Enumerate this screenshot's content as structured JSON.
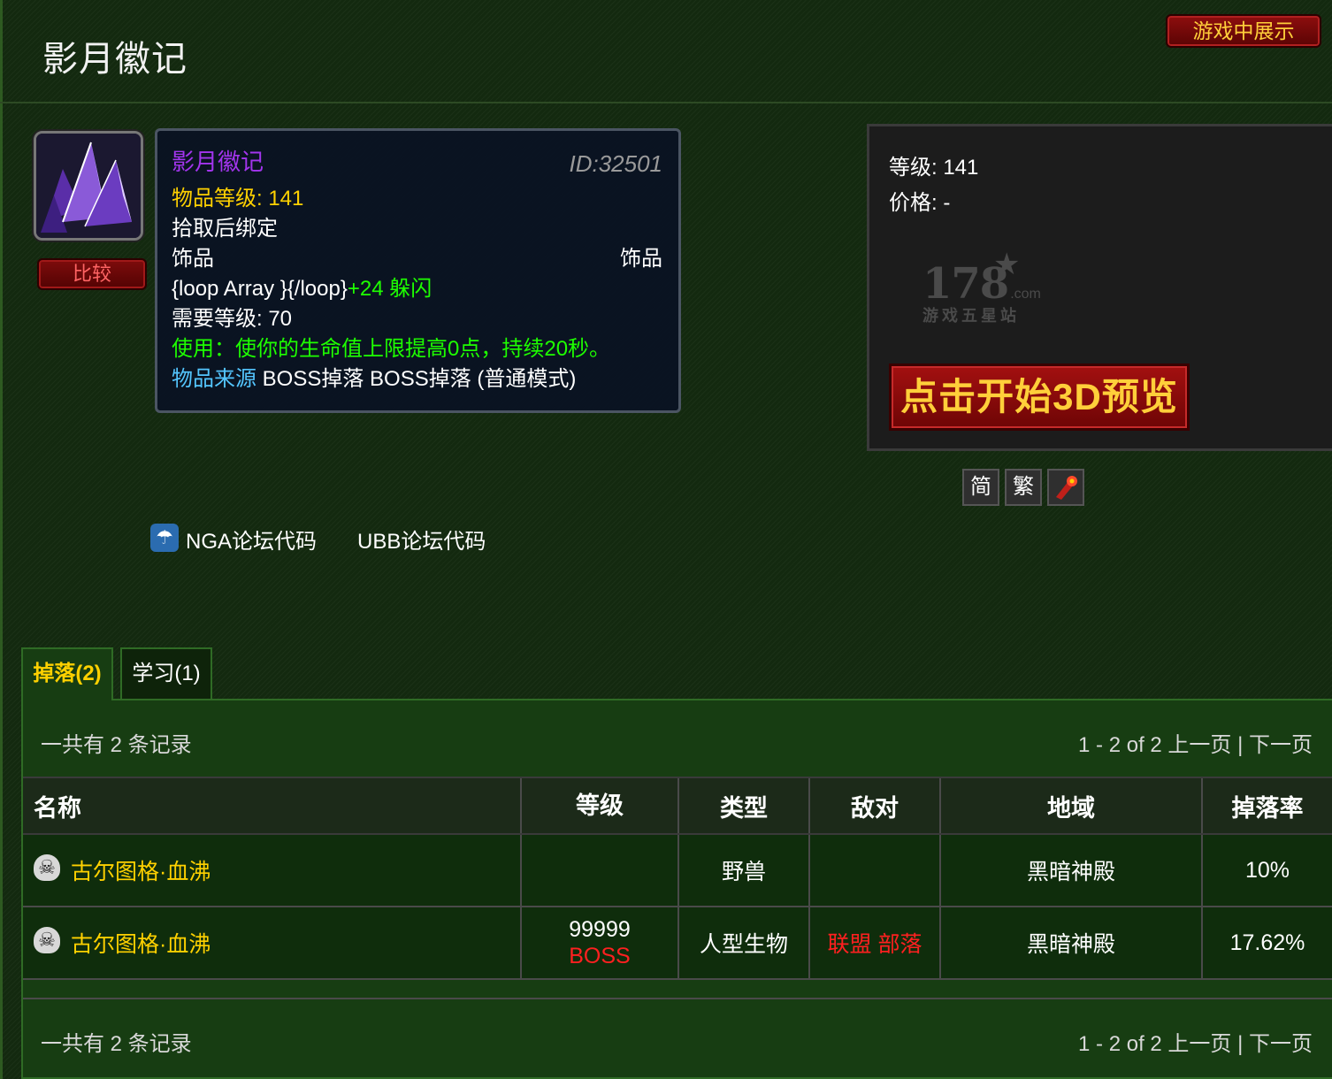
{
  "header": {
    "title": "影月徽记",
    "ingame_button": "游戏中展示"
  },
  "item": {
    "icon": "purple-crystal-icon",
    "compare_button": "比较",
    "tooltip": {
      "name": "影月徽记",
      "id": "ID:32501",
      "item_level": "物品等级: 141",
      "bind": "拾取后绑定",
      "slot": "饰品",
      "slot_type": "饰品",
      "stat_prefix": "{loop Array }{/loop}",
      "stat_bonus": "+24 躲闪",
      "required_level": "需要等级: 70",
      "use_effect": "使用：使你的生命值上限提高0点，持续20秒。",
      "source_label": "物品来源",
      "source_value": " BOSS掉落 BOSS掉落 (普通模式)"
    }
  },
  "info": {
    "level": "等级: 141",
    "price": "价格: -",
    "watermark_num": "178",
    "watermark_com": ".com",
    "watermark_sub": "游戏五星站",
    "preview_button": "点击开始3D预览"
  },
  "lang_buttons": {
    "simplified": "简",
    "traditional": "繁",
    "tool_icon": "wowhead-tool-icon"
  },
  "forum": {
    "nga_label": "NGA论坛代码",
    "ubb_label": "UBB论坛代码"
  },
  "tabs": [
    {
      "label": "掉落(2)",
      "active": true
    },
    {
      "label": "学习(1)",
      "active": false
    }
  ],
  "drops": {
    "count_text": "一共有 2 条记录",
    "pager_text": "1 - 2 of 2 上一页 | 下一页",
    "columns": [
      "名称",
      "等级",
      "类型",
      "敌对",
      "地域",
      "掉落率"
    ],
    "rows": [
      {
        "name": "古尔图格·血沸",
        "level": "",
        "level_tag": "",
        "type": "野兽",
        "react_a": "",
        "react_b": "",
        "zone": "黑暗神殿",
        "drop": "10%"
      },
      {
        "name": "古尔图格·血沸",
        "level": "99999",
        "level_tag": "BOSS",
        "type": "人型生物",
        "react_a": "联盟",
        "react_b": "部落",
        "zone": "黑暗神殿",
        "drop": "17.62%"
      }
    ]
  },
  "colors": {
    "epic": "#a335ee",
    "uncommon": "#1eff00",
    "gold": "#ffd100",
    "hostile": "#ff2020"
  }
}
